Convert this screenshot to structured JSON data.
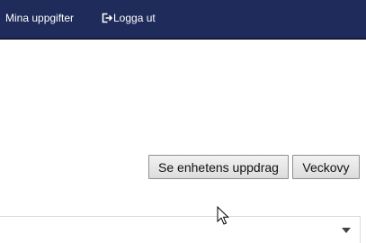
{
  "nav": {
    "my_tasks": "Mina uppgifter",
    "logout": "Logga ut",
    "logout_icon": "sign-out-icon",
    "background": "#1f2b5a"
  },
  "actions": {
    "unit_assignments": "Se enhetens uppdrag",
    "week_view": "Veckovy"
  },
  "dropdown": {
    "selected": "",
    "icon": "caret-down-icon"
  }
}
